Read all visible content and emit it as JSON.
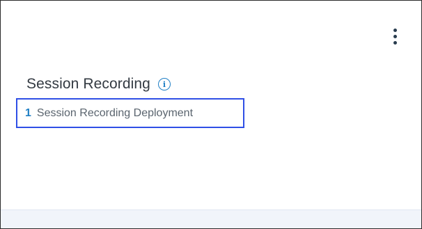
{
  "card": {
    "title": "Session Recording",
    "deployment": {
      "count": "1",
      "label": "Session Recording Deployment"
    },
    "menu_icon": "more-vertical-icon",
    "info_icon": "info-icon"
  },
  "colors": {
    "accent": "#1f7fc5",
    "highlight_border": "#2f4fe6",
    "title_text": "#333a42",
    "label_text": "#5a646e",
    "footer_bg": "#f1f4fa"
  }
}
